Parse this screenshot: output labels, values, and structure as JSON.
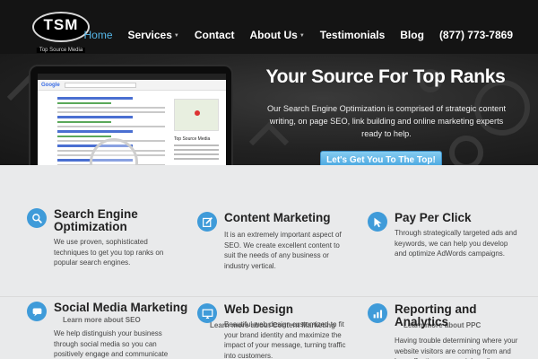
{
  "header": {
    "logo": {
      "mark": "TSM",
      "subtitle": "Top Source Media"
    },
    "nav": [
      {
        "label": "Home",
        "active": true,
        "caret": false
      },
      {
        "label": "Services",
        "active": false,
        "caret": true
      },
      {
        "label": "Contact",
        "active": false,
        "caret": false
      },
      {
        "label": "About Us",
        "active": false,
        "caret": true
      },
      {
        "label": "Testimonials",
        "active": false,
        "caret": false
      },
      {
        "label": "Blog",
        "active": false,
        "caret": false
      },
      {
        "label": "(877) 773-7869",
        "active": false,
        "caret": false
      }
    ],
    "caret_glyph": "▼"
  },
  "hero": {
    "title": "Your Source For Top Ranks",
    "text": "Our Search Engine Optimization is comprised of strategic content writing, on page SEO, link building and online marketing experts ready to help.",
    "button_label": "Let's Get You To The Top!",
    "tablet": {
      "google_label": "Google",
      "listing_title": "Top Source Media"
    }
  },
  "features": [
    {
      "icon": "search-icon",
      "title": "Search Engine Optimization",
      "text": "We use proven, sophisticated techniques to get you top ranks on popular search engines.",
      "link": "Learn more about SEO"
    },
    {
      "icon": "edit-icon",
      "title": "Content Marketing",
      "text": "It is an extremely important aspect of SEO. We create excellent content to suit the needs of any business or industry vertical.",
      "link": "Learn more about Content Marketing"
    },
    {
      "icon": "cursor-icon",
      "title": "Pay Per Click",
      "text": "Through strategically targeted ads and keywords, we can help you develop and optimize AdWords campaigns.",
      "link": "Learn more about PPC"
    },
    {
      "icon": "chat-icon",
      "title": "Social Media Marketing",
      "text": "We help distinguish your business through social media so you can positively engage and communicate",
      "link": ""
    },
    {
      "icon": "monitor-icon",
      "title": "Web Design",
      "text": "Beautiful web design customized to fit your brand identity and maximize the impact of your message, turning traffic into customers.",
      "link": ""
    },
    {
      "icon": "chart-icon",
      "title": "Reporting and Analytics",
      "text": "Having trouble determining where your website visitors are coming from and how effective your social media",
      "link": ""
    }
  ],
  "colors": {
    "accent": "#55b6e8",
    "icon_bg": "#3f9bd9",
    "header_bg": "#141414"
  }
}
